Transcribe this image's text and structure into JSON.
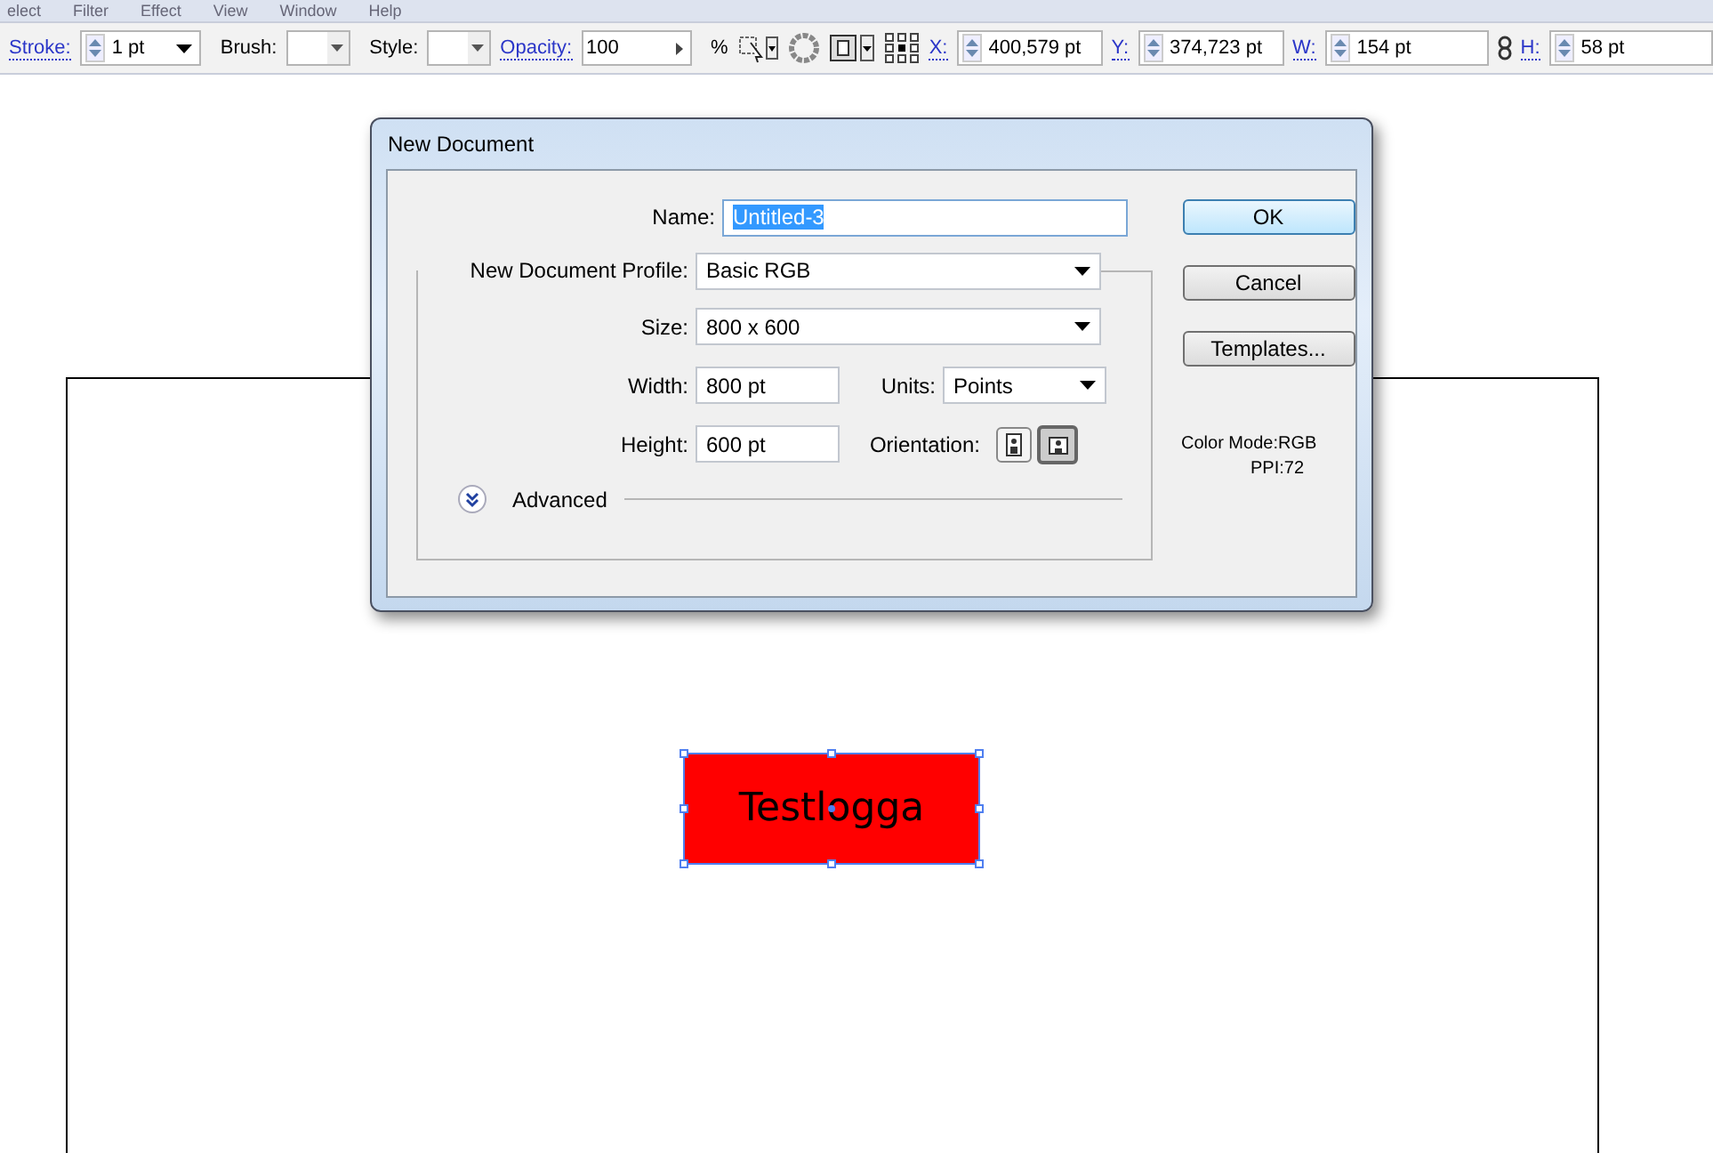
{
  "menu_bar": {
    "items": [
      "elect",
      "Filter",
      "Effect",
      "View",
      "Window",
      "Help"
    ]
  },
  "control_bar": {
    "stroke": {
      "label": "Stroke:",
      "value": "1 pt"
    },
    "brush": {
      "label": "Brush:"
    },
    "style": {
      "label": "Style:"
    },
    "opacity": {
      "label": "Opacity:",
      "value": "100",
      "unit": "%"
    },
    "position": [
      {
        "label": "X:",
        "value": "400,579 pt"
      },
      {
        "label": "Y:",
        "value": "374,723 pt"
      },
      {
        "label": "W:",
        "value": "154 pt"
      },
      {
        "label": "H:",
        "value": "58 pt"
      }
    ]
  },
  "canvas": {
    "logo": {
      "text": "Testlogga",
      "selected": true
    }
  },
  "dialog": {
    "title": "New Document",
    "name": {
      "label": "Name:",
      "value": "Untitled-3",
      "selected": true
    },
    "profile": {
      "label": "New Document Profile:",
      "value": "Basic RGB"
    },
    "size": {
      "label": "Size:",
      "value": "800 x 600"
    },
    "width": {
      "label": "Width:",
      "value": "800 pt"
    },
    "units": {
      "label": "Units:",
      "value": "Points"
    },
    "height": {
      "label": "Height:",
      "value": "600 pt"
    },
    "orientation": {
      "label": "Orientation:",
      "options": [
        {
          "kind": "portrait",
          "selected": false
        },
        {
          "kind": "landscape",
          "selected": true
        }
      ]
    },
    "advanced": {
      "label": "Advanced",
      "expanded": false
    },
    "buttons": [
      {
        "label": "OK",
        "default": true
      },
      {
        "label": "Cancel",
        "default": false
      },
      {
        "label": "Templates...",
        "default": false
      }
    ],
    "info": [
      "Color Mode:RGB",
      "PPI:72"
    ]
  }
}
